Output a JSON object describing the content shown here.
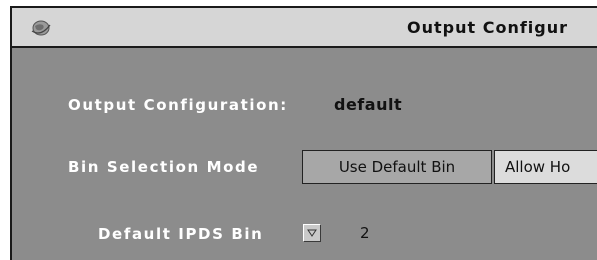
{
  "window": {
    "title": "Output Configur",
    "icon": "app-globe-icon"
  },
  "form": {
    "output_config_label": "Output Configuration:",
    "output_config_value": "default",
    "bin_mode_label": "Bin Selection Mode",
    "bin_mode_options": [
      "Use Default Bin",
      "Allow Ho"
    ],
    "bin_mode_selected": "Use Default Bin",
    "default_bin_label": "Default IPDS Bin",
    "default_bin_value": "2"
  },
  "colors": {
    "panel_bg": "#8c8c8c",
    "titlebar_bg": "#d6d6d6",
    "label_text": "#ffffff",
    "selected_segment": "#a7a7a7",
    "unselected_segment": "#dcdcdc"
  }
}
